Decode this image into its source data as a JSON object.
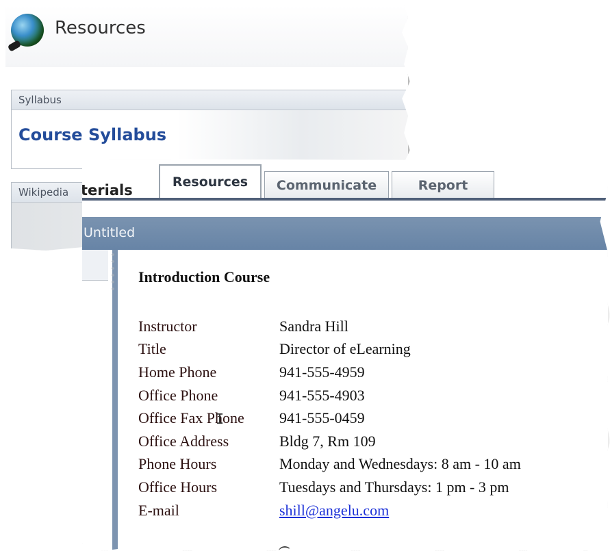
{
  "back_window": {
    "title": "Resources",
    "panels": [
      {
        "header": "Syllabus",
        "link": "Course Syllabus"
      },
      {
        "header": "Wikipedia"
      }
    ]
  },
  "front_window": {
    "tabs": [
      {
        "label": "terials"
      },
      {
        "label": "Resources",
        "active": true
      },
      {
        "label": "Communicate"
      },
      {
        "label": "Report"
      }
    ],
    "titlebar": "Untitled",
    "content": {
      "heading": "Introduction Course",
      "rows": [
        {
          "label": "Instructor",
          "value": "Sandra Hill"
        },
        {
          "label": "Title",
          "value": "Director of eLearning"
        },
        {
          "label": "Home Phone",
          "value": "941-555-4959"
        },
        {
          "label": "Office Phone",
          "value": "941-555-4903"
        },
        {
          "label": "Office Fax Phone",
          "value": "941-555-0459"
        },
        {
          "label": "Office Address",
          "value": "Bldg 7, Rm 109"
        },
        {
          "label": "Phone Hours",
          "value": "Monday and Wednesdays: 8 am - 10 am"
        },
        {
          "label": "Office Hours",
          "value": "Tuesdays and Thursdays: 1 pm - 3 pm"
        },
        {
          "label": "E-mail",
          "value": "shill@angelu.com",
          "link": true
        }
      ]
    }
  },
  "colors": {
    "link_blue": "#1a2fd8",
    "titlebar": "#6f8aab",
    "syllabus_link": "#234c9a"
  }
}
